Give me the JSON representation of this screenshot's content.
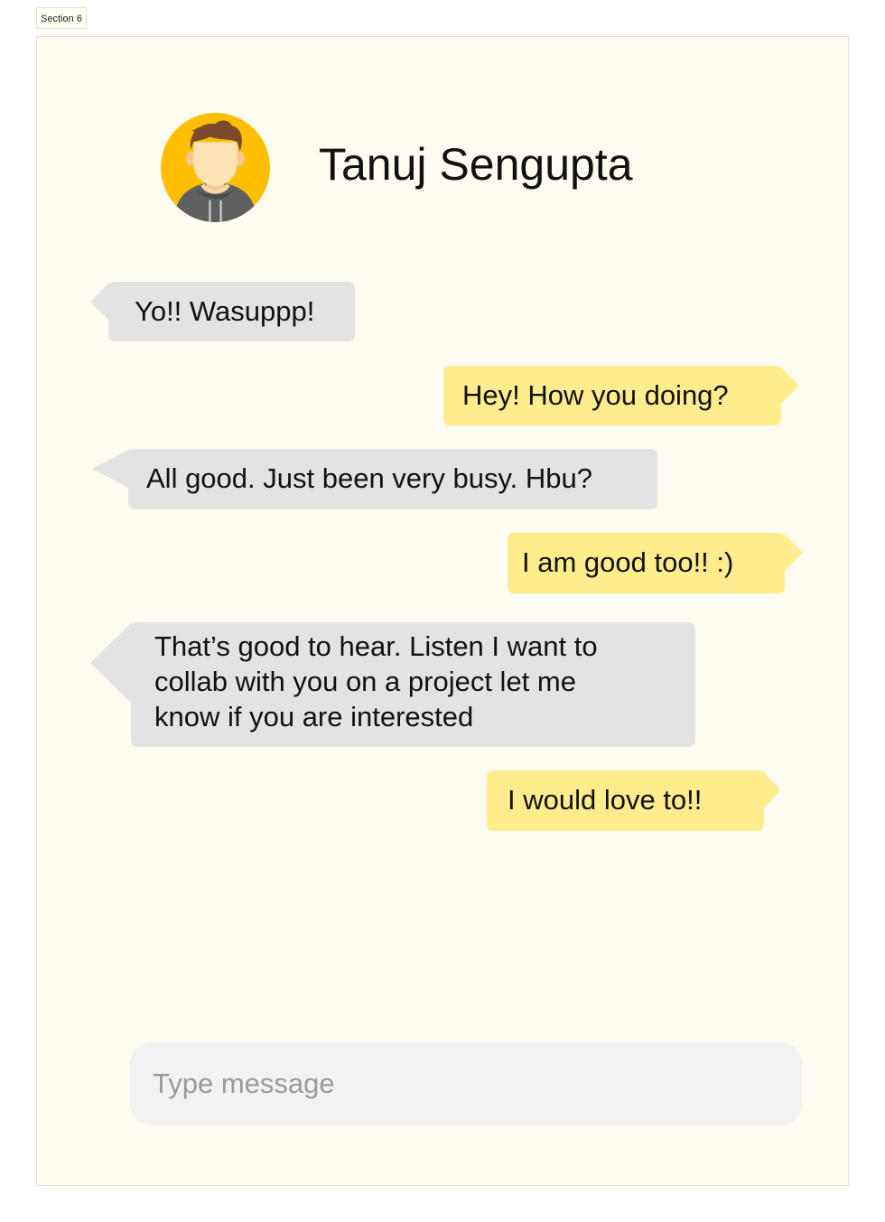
{
  "section": {
    "label": "Section 6"
  },
  "chat": {
    "contact_name": "Tanuj Sengupta",
    "avatar": {
      "icon": "user-avatar-icon",
      "background": "#ffbe00"
    }
  },
  "messages": [
    {
      "direction": "received",
      "text": "Yo!! Wasuppp!"
    },
    {
      "direction": "sent",
      "text": "Hey! How you doing?"
    },
    {
      "direction": "received",
      "text": "All good. Just been very busy. Hbu?"
    },
    {
      "direction": "sent",
      "text": "I am good too!! :)"
    },
    {
      "direction": "received",
      "lines": [
        "That’s good to hear. Listen I want to",
        "collab with you on a project let me",
        "know if you are interested"
      ]
    },
    {
      "direction": "sent",
      "text": "I would love to!!"
    }
  ],
  "composer": {
    "placeholder": "Type message",
    "value": ""
  },
  "colors": {
    "frame_background": "#fefbf1",
    "received_bubble": "#e3e3e3",
    "sent_bubble": "#feec8d",
    "input_background": "#f2f2f2"
  }
}
